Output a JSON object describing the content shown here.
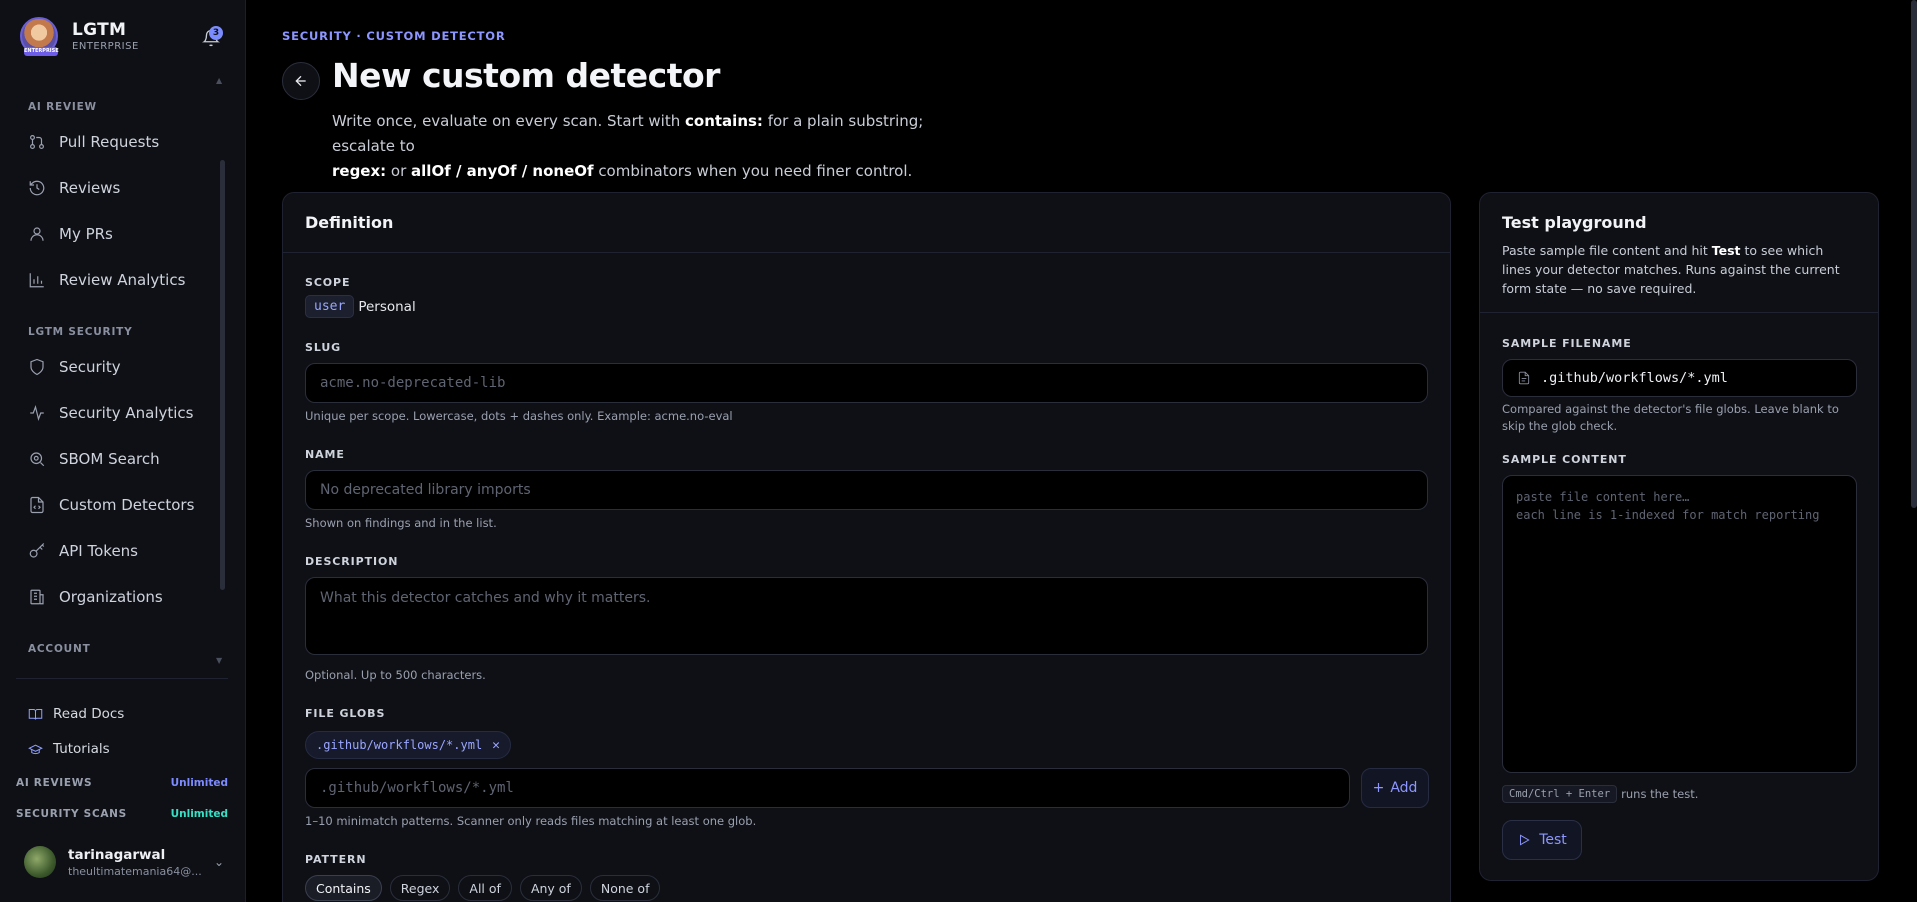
{
  "brand": {
    "name": "LGTM",
    "subtitle": "ENTERPRISE",
    "logo_badge": "ENTERPRISE",
    "notifications": "3"
  },
  "sidebar": {
    "ai_review_label": "AI REVIEW",
    "ai_items": [
      "Pull Requests",
      "Reviews",
      "My PRs",
      "Review Analytics"
    ],
    "security_label": "LGTM SECURITY",
    "security_items": [
      "Security",
      "Security Analytics",
      "SBOM Search",
      "Custom Detectors",
      "API Tokens",
      "Organizations"
    ],
    "account_label": "ACCOUNT",
    "docs": [
      "Read Docs",
      "Tutorials"
    ],
    "quotas": [
      {
        "label": "AI REVIEWS",
        "value": "Unlimited"
      },
      {
        "label": "SECURITY SCANS",
        "value": "Unlimited"
      }
    ],
    "user": {
      "name": "tarinagarwal",
      "email": "theultimatemania64@..."
    }
  },
  "header": {
    "breadcrumb": "SECURITY · CUSTOM DETECTOR",
    "title": "New custom detector",
    "desc_1": "Write once, evaluate on every scan. Start with ",
    "desc_b1": "contains:",
    "desc_2": " for a plain substring; escalate to ",
    "desc_b2": "regex:",
    "desc_3": " or ",
    "desc_b3": "allOf / anyOf / noneOf",
    "desc_4": " combinators when you need finer control."
  },
  "definition": {
    "title": "Definition",
    "scope_label": "SCOPE",
    "scope_chip": "user",
    "scope_value": "Personal",
    "slug_label": "SLUG",
    "slug_placeholder": "acme.no-deprecated-lib",
    "slug_hint": "Unique per scope. Lowercase, dots + dashes only. Example: acme.no-eval",
    "name_label": "NAME",
    "name_placeholder": "No deprecated library imports",
    "name_hint": "Shown on findings and in the list.",
    "desc_label": "DESCRIPTION",
    "desc_placeholder": "What this detector catches and why it matters.",
    "desc_hint": "Optional. Up to 500 characters.",
    "globs_label": "FILE GLOBS",
    "glob_chip": ".github/workflows/*.yml",
    "glob_placeholder": ".github/workflows/*.yml",
    "add_label": "Add",
    "globs_hint": "1–10 minimatch patterns. Scanner only reads files matching at least one glob.",
    "pattern_label": "PATTERN",
    "pattern_options": [
      "Contains",
      "Regex",
      "All of",
      "Any of",
      "None of"
    ],
    "pattern_selected": "Contains"
  },
  "playground": {
    "title": "Test playground",
    "desc_1": "Paste sample file content and hit ",
    "desc_b": "Test",
    "desc_2": " to see which lines your detector matches. Runs against the current form state — no save required.",
    "filename_label": "SAMPLE FILENAME",
    "filename_value": ".github/workflows/*.yml",
    "filename_hint": "Compared against the detector's file globs. Leave blank to skip the glob check.",
    "content_label": "SAMPLE CONTENT",
    "content_placeholder_1": "paste file content here…",
    "content_placeholder_2": "each line is 1-indexed for match reporting",
    "kbd": "Cmd/Ctrl + Enter",
    "kbd_hint": "runs the test.",
    "test_label": "Test"
  }
}
